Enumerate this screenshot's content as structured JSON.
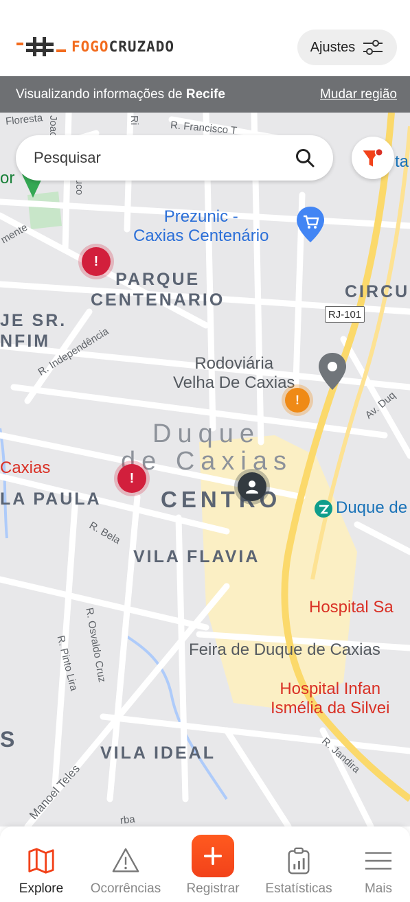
{
  "header": {
    "logo_text_a": "FOGO",
    "logo_text_b": "CRUZADO",
    "settings_label": "Ajustes"
  },
  "region": {
    "prefix": "Visualizando informações de ",
    "city": "Recife",
    "change_label": "Mudar região"
  },
  "search": {
    "placeholder": "Pesquisar"
  },
  "map": {
    "streets": {
      "floresta": "Floresta",
      "francisco": "R. Francisco T",
      "independencia": "R. Independência",
      "bela": "R. Bela",
      "osvaldo": "R. Osvaldo Cruz",
      "pinto_lira": "R. Pinto Lira",
      "manoel_teles": "Manoel Teles",
      "jandira": "R. Jandira",
      "av_duque": "Av. Duq",
      "mente": "mente",
      "joao": "Joao",
      "ri": "Ri",
      "uco": "uco",
      "rba": "rba"
    },
    "districts": {
      "parque": "PARQUE\nCENTENARIO",
      "sr": "JE SR.\nNFIM",
      "paula": "LA PAULA",
      "centro": "CENTRO",
      "vila_flavia": "VILA FLAVIA",
      "vila_ideal": "VILA IDEAL",
      "circu": "CIRCU",
      "s_edge": "S"
    },
    "city": {
      "line1": "Duque",
      "line2": "de Caxias"
    },
    "pois": {
      "prezunic": "Prezunic -\nCaxias Centenário",
      "rodoviaria": "Rodoviária\nVelha De Caxias",
      "duque_de": "Duque de",
      "hospital_sa": "Hospital Sa",
      "feira": "Feira de Duque de Caxias",
      "hospital_infantil": "Hospital Infan\nIsmélia da Silvei",
      "caxias_left": "Caxias",
      "tar": "ta",
      "or": "or"
    },
    "road_shield": "RJ-101",
    "markers": {
      "red_symbol": "!",
      "orange_symbol": "!"
    }
  },
  "nav": {
    "items": [
      {
        "label": "Explore",
        "icon": "map-icon",
        "active": true
      },
      {
        "label": "Ocorrências",
        "icon": "warning-icon",
        "active": false
      },
      {
        "label": "Registrar",
        "icon": "plus-icon",
        "active": false
      },
      {
        "label": "Estatísticas",
        "icon": "stats-icon",
        "active": false
      },
      {
        "label": "Mais",
        "icon": "menu-icon",
        "active": false
      }
    ]
  },
  "colors": {
    "accent": "#f26b1d",
    "region_bar": "#6e7073",
    "marker_red": "#d21f3c",
    "marker_orange": "#ef8a16"
  }
}
